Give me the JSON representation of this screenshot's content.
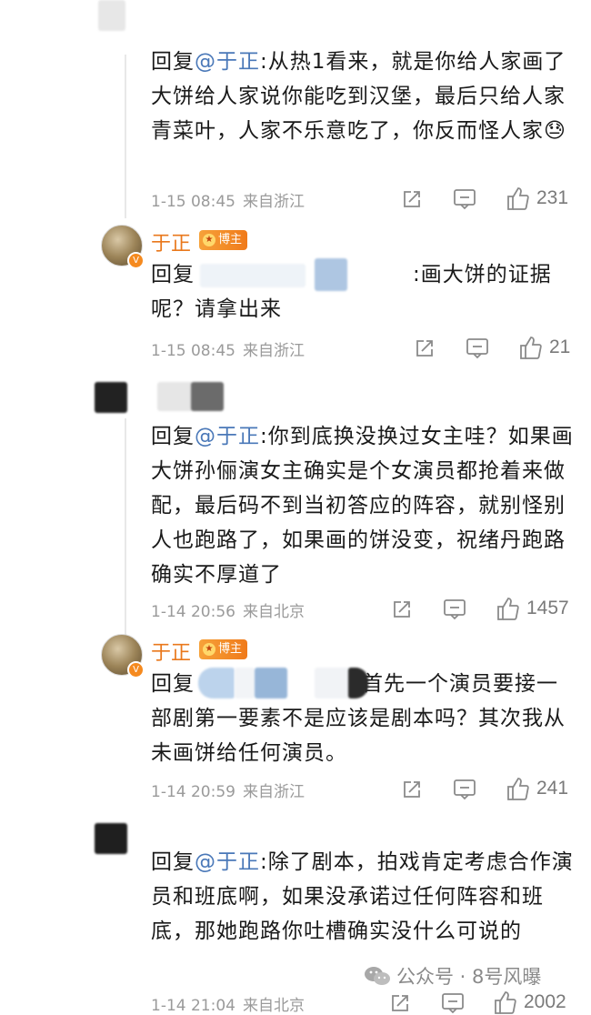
{
  "comments": [
    {
      "prefix": "回复",
      "mention": "@于正",
      "colon": ":",
      "text": "从热1看来，就是你给人家画了大饼给人家说你能吃到汉堡，最后只给人家青菜叶，人家不乐意吃了，你反而怪人家",
      "emoji": "😓",
      "time": "1-15 08:45",
      "location": "来自浙江",
      "likes": "231"
    },
    {
      "author": "于正",
      "badge": "博主",
      "prefix": "回复",
      "text": ":画大饼的证据呢？请拿出来",
      "time": "1-15 08:45",
      "location": "来自浙江",
      "likes": "21"
    },
    {
      "prefix": "回复",
      "mention": "@于正",
      "colon": ":",
      "text": "你到底换没换过女主哇？如果画大饼孙俪演女主确实是个女演员都抢着来做配，最后码不到当初答应的阵容，就别怪别人也跑路了，如果画的饼没变，祝绪丹跑路确实不厚道了",
      "time": "1-14 20:56",
      "location": "来自北京",
      "likes": "1457"
    },
    {
      "author": "于正",
      "badge": "博主",
      "prefix": "回复",
      "text": "首先一个演员要接一部剧第一要素不是应该是剧本吗？其次我从未画饼给任何演员。",
      "time": "1-14 20:59",
      "location": "来自浙江",
      "likes": "241"
    },
    {
      "prefix": "回复",
      "mention": "@于正",
      "colon": ":",
      "text": "除了剧本，拍戏肯定考虑合作演员和班底啊，如果没承诺过任何阵容和班底，那她跑路你吐槽确实没什么可说的",
      "time": "1-14 21:04",
      "location": "来自北京",
      "likes": "2002"
    }
  ],
  "watermark": "公众号 · 8号风曝",
  "icons": [
    "share-icon",
    "comment-icon",
    "like-icon",
    "wechat-icon"
  ]
}
